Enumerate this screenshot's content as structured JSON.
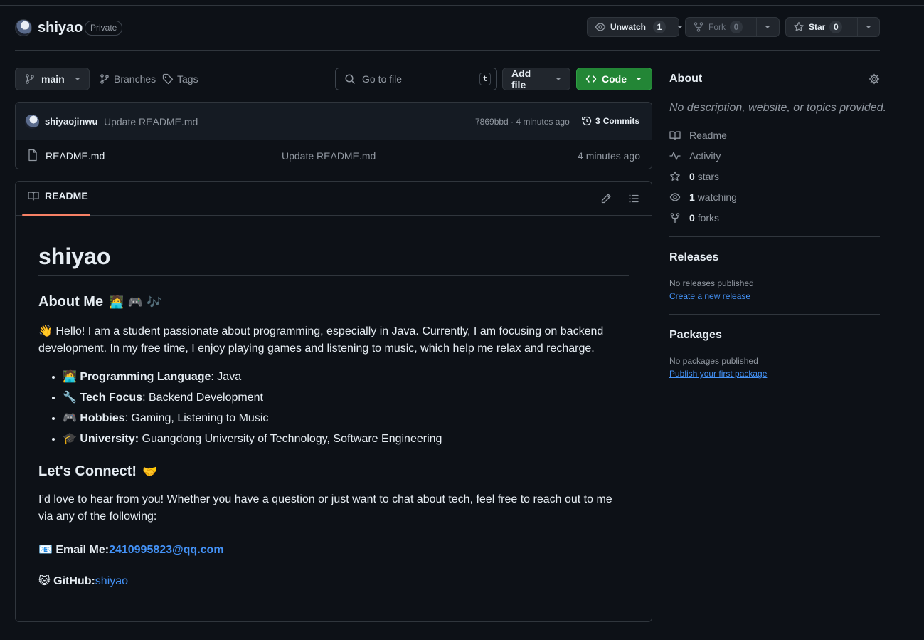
{
  "repo": {
    "name": "shiyao",
    "visibility": "Private"
  },
  "actions": {
    "unwatch_label": "Unwatch",
    "unwatch_count": "1",
    "fork_label": "Fork",
    "fork_count": "0",
    "star_label": "Star",
    "star_count": "0"
  },
  "toolbar": {
    "branch": "main",
    "branches_label": "Branches",
    "tags_label": "Tags",
    "search_placeholder": "Go to file",
    "search_shortcut": "t",
    "add_file_label": "Add file",
    "code_label": "Code"
  },
  "commit": {
    "author": "shiyaojinwu",
    "message": "Update README.md",
    "hash_time": "7869bbd · 4 minutes ago",
    "commits_count": "3",
    "commits_label": "Commits"
  },
  "files": [
    {
      "name": "README.md",
      "message": "Update README.md",
      "time": "4 minutes ago"
    }
  ],
  "readme": {
    "tab_label": "README",
    "title": "shiyao",
    "about_heading": "About Me",
    "about_emojis": "🧑‍💻 🎮 🎶",
    "intro_emoji": "👋",
    "intro": "Hello! I am a student passionate about programming, especially in Java. Currently, I am focusing on backend development. In my free time, I enjoy playing games and listening to music, which help me relax and recharge.",
    "items": [
      {
        "emoji": "🧑‍💻",
        "label": "Programming Language",
        "sep": ":",
        "value": " Java"
      },
      {
        "emoji": "🔧",
        "label": "Tech Focus",
        "sep": ":",
        "value": " Backend Development"
      },
      {
        "emoji": "🎮",
        "label": "Hobbies",
        "sep": ":",
        "value": " Gaming, Listening to Music"
      },
      {
        "emoji": "🎓",
        "label": "University:",
        "sep": "",
        "value": " Guangdong University of Technology, Software Engineering"
      }
    ],
    "connect_heading": "Let's Connect!",
    "connect_emoji": "🤝",
    "connect_text": "I’d love to hear from you! Whether you have a question or just want to chat about tech, feel free to reach out to me via any of the following:",
    "email_emoji": "📧",
    "email_label": "Email Me:",
    "email_value": "2410995823@qq.com",
    "github_emoji": "😺",
    "github_label": "GitHub:",
    "github_value": "shiyao"
  },
  "sidebar": {
    "about_heading": "About",
    "description": "No description, website, or topics provided.",
    "readme_label": "Readme",
    "activity_label": "Activity",
    "stars_count": "0",
    "stars_label": "stars",
    "watching_count": "1",
    "watching_label": "watching",
    "forks_count": "0",
    "forks_label": "forks",
    "releases_heading": "Releases",
    "releases_text": "No releases published",
    "releases_link": "Create a new release",
    "packages_heading": "Packages",
    "packages_text": "No packages published",
    "packages_link": "Publish your first package"
  },
  "colors": {
    "background": "#0d1117",
    "border": "#30363d",
    "accent_green": "#238636",
    "link": "#4493f8",
    "tab_underline": "#f78166"
  }
}
